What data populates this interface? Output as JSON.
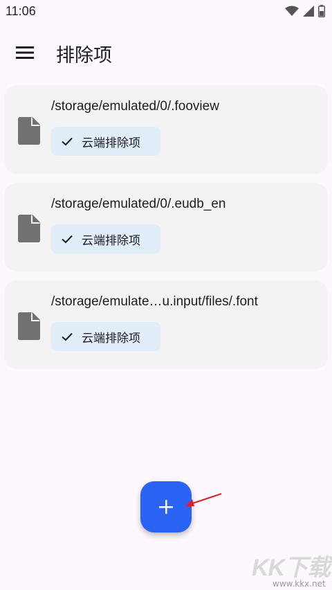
{
  "status_bar": {
    "time": "11:06",
    "icons": [
      "wifi-icon",
      "cellular-signal-icon",
      "battery-icon"
    ]
  },
  "app_bar": {
    "menu_icon": "hamburger-menu-icon",
    "title": "排除项"
  },
  "exclusions": [
    {
      "path": "/storage/emulated/0/.fooview",
      "chip_label": "云端排除项",
      "icon": "file-icon"
    },
    {
      "path": "/storage/emulated/0/.eudb_en",
      "chip_label": "云端排除项",
      "icon": "file-icon"
    },
    {
      "path": "/storage/emulate…u.input/files/.font",
      "chip_label": "云端排除项",
      "icon": "file-icon"
    }
  ],
  "fab": {
    "icon": "plus-icon",
    "color": "#2b63f5"
  },
  "annotation": {
    "icon": "red-arrow-icon",
    "color": "#d6202a"
  },
  "watermark": {
    "brand": "KK下载",
    "url": "www.kkx.net"
  },
  "colors": {
    "background": "#fdf8fd",
    "card": "#f3f3f3",
    "chip": "#e1eefa",
    "accent": "#2b63f5"
  }
}
